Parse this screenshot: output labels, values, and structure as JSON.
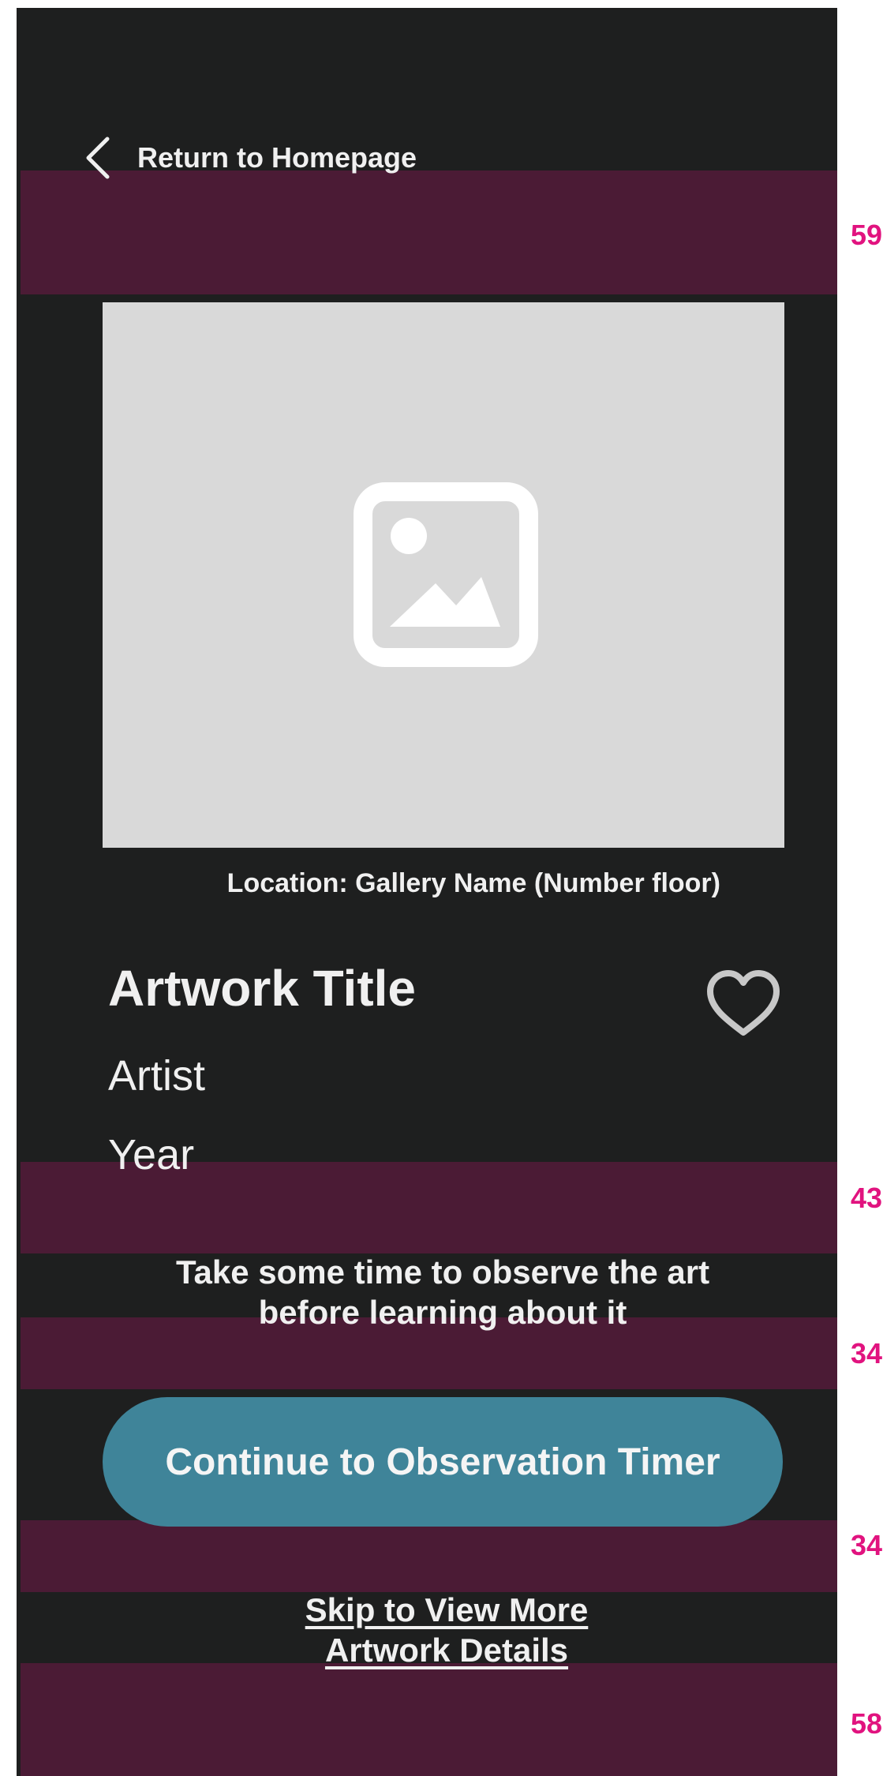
{
  "nav": {
    "back_label": "Return to Homepage",
    "back_icon": "chevron-left-icon"
  },
  "artwork": {
    "image_icon": "image-placeholder-icon",
    "location": "Location: Gallery Name (Number floor)",
    "title": "Artwork Title",
    "artist": "Artist",
    "year": "Year",
    "favorite_icon": "heart-icon"
  },
  "prompt": {
    "line1": "Take some time to observe the art",
    "line2": "before learning about it"
  },
  "actions": {
    "continue_label": "Continue to Observation Timer",
    "skip_line1": "Skip to View More",
    "skip_line2": "Artwork Details"
  },
  "spacers": {
    "top": "59",
    "after_year": "43",
    "after_prompt": "34",
    "after_button": "34",
    "bottom": "58"
  },
  "colors": {
    "background": "#1e1f1f",
    "spacer_band": "#4b1b35",
    "spacer_label": "#e1137f",
    "button": "#3f8499",
    "image_placeholder": "#d9d9d9",
    "text": "#f0f0f0"
  }
}
